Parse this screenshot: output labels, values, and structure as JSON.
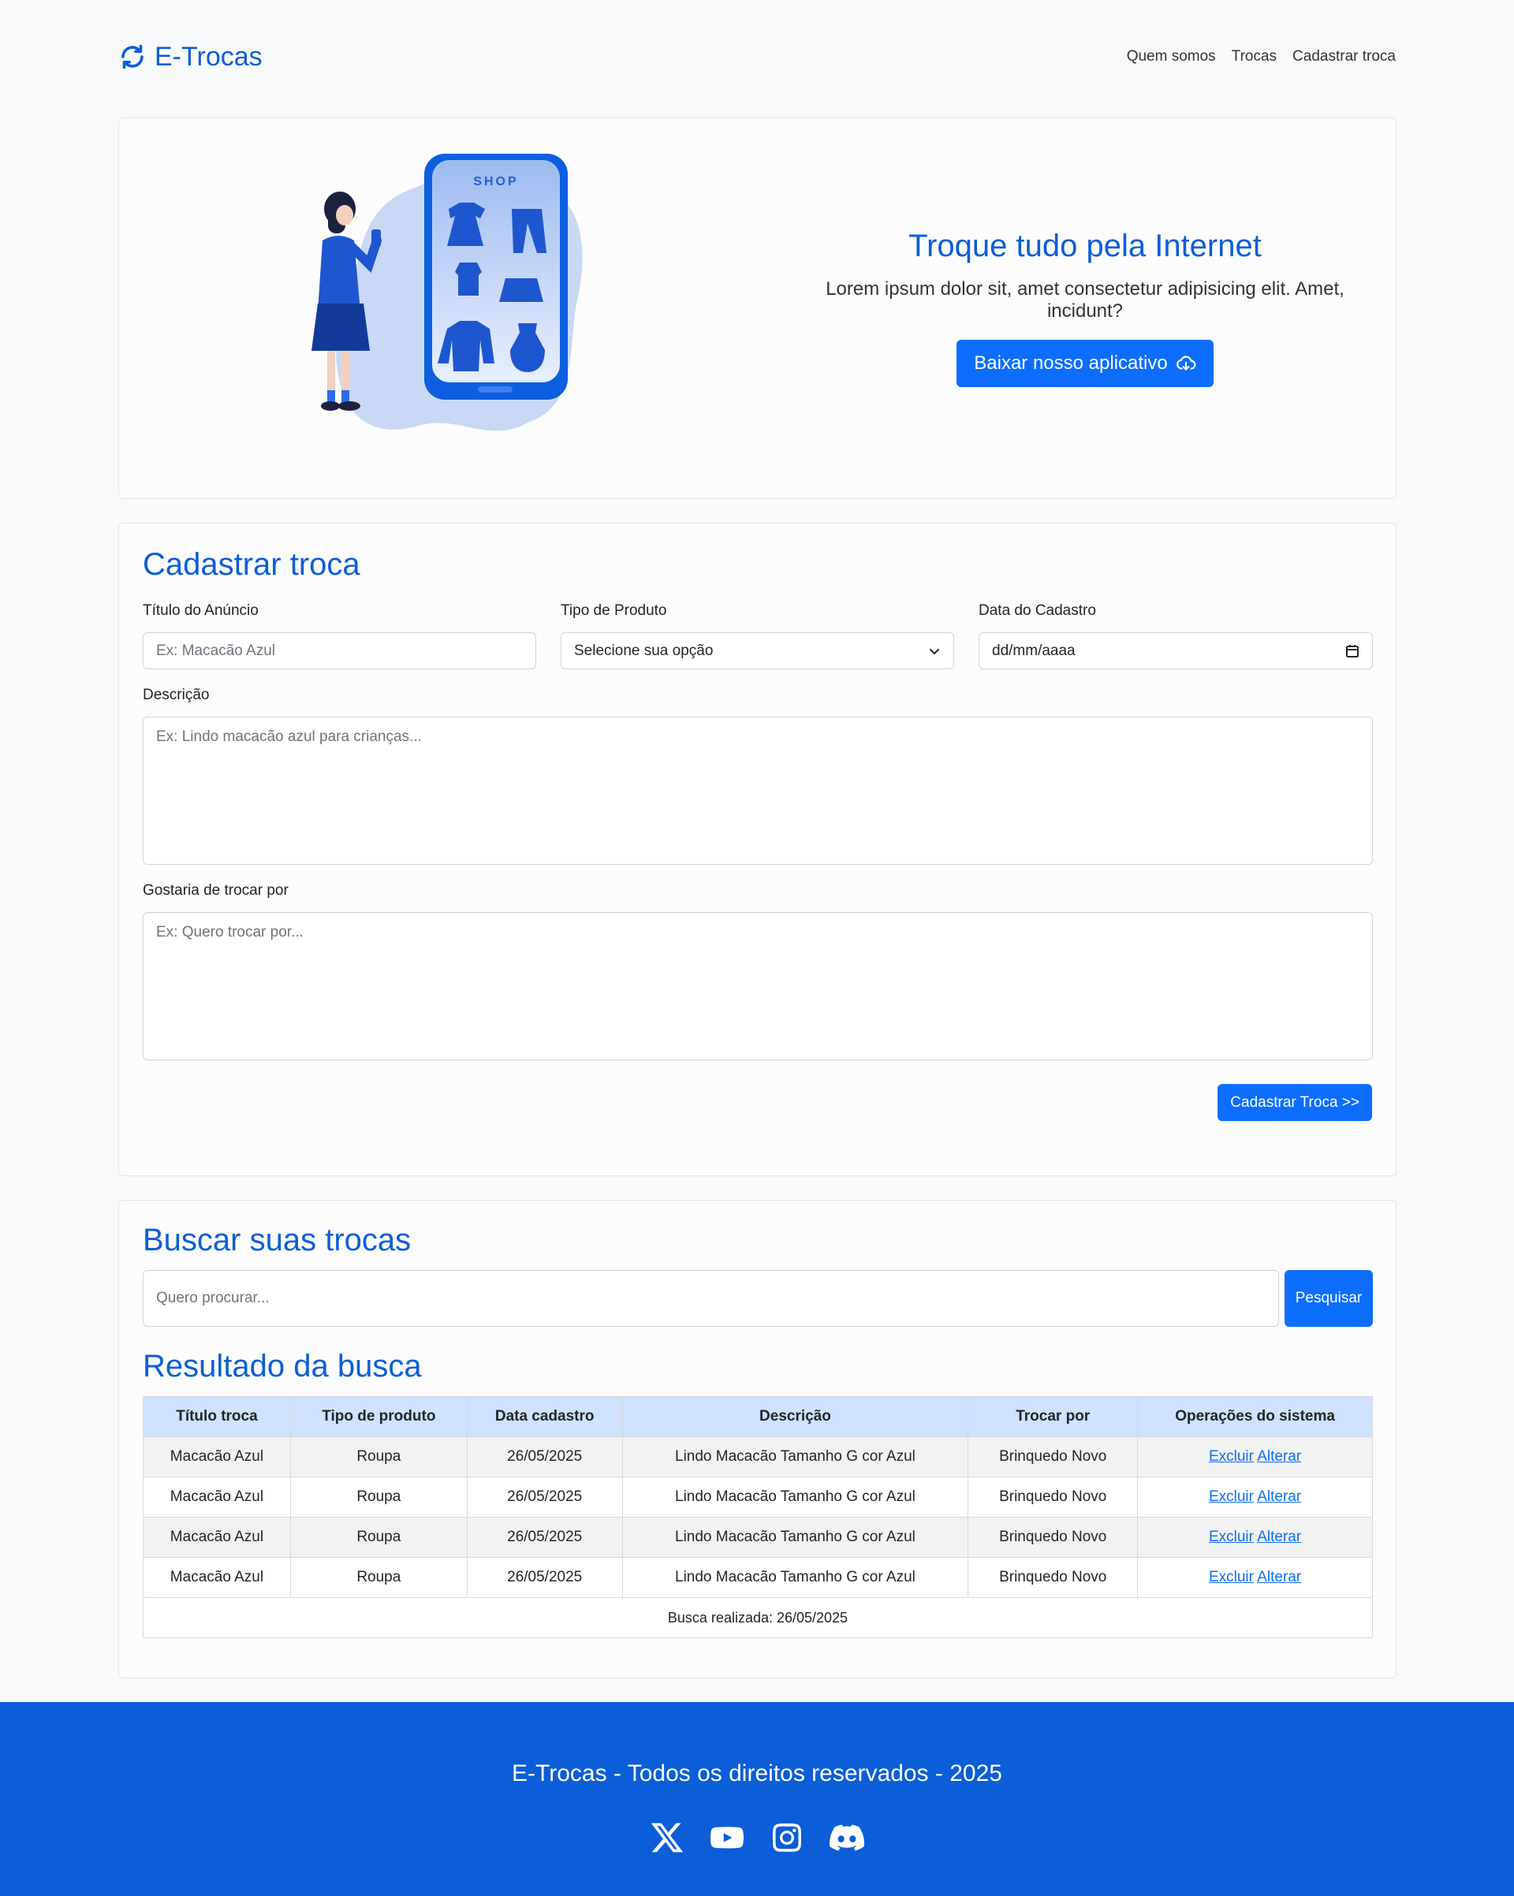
{
  "header": {
    "brand": "E-Trocas",
    "nav": [
      "Quem somos",
      "Trocas",
      "Cadastrar troca"
    ]
  },
  "hero": {
    "title": "Troque tudo pela Internet",
    "subtitle": "Lorem ipsum dolor sit, amet consectetur adipisicing elit. Amet, incidunt?",
    "button_label": "Baixar nosso aplicativo",
    "illustration_text": "SHOP"
  },
  "form": {
    "title": "Cadastrar troca",
    "titulo_label": "Título do Anúncio",
    "titulo_placeholder": "Ex: Macacão Azul",
    "tipo_label": "Tipo de Produto",
    "tipo_value": "Selecione sua opção",
    "data_label": "Data do Cadastro",
    "data_value": "dd/mm/aaaa",
    "descricao_label": "Descrição",
    "descricao_placeholder": "Ex: Lindo macacão azul para crianças...",
    "trocar_label": "Gostaria de trocar por",
    "trocar_placeholder": "Ex: Quero trocar por...",
    "submit_label": "Cadastrar Troca >>"
  },
  "search": {
    "title": "Buscar suas trocas",
    "placeholder": "Quero procurar...",
    "button_label": "Pesquisar",
    "results_title": "Resultado da busca",
    "columns": [
      "Título troca",
      "Tipo de produto",
      "Data cadastro",
      "Descrição",
      "Trocar por",
      "Operações do sistema"
    ],
    "rows": [
      {
        "titulo": "Macacão Azul",
        "tipo": "Roupa",
        "data": "26/05/2025",
        "descricao": "Lindo Macacão Tamanho G cor Azul",
        "trocar": "Brinquedo Novo",
        "excluir": "Excluir",
        "alterar": "Alterar"
      },
      {
        "titulo": "Macacão Azul",
        "tipo": "Roupa",
        "data": "26/05/2025",
        "descricao": "Lindo Macacão Tamanho G cor Azul",
        "trocar": "Brinquedo Novo",
        "excluir": "Excluir",
        "alterar": "Alterar"
      },
      {
        "titulo": "Macacão Azul",
        "tipo": "Roupa",
        "data": "26/05/2025",
        "descricao": "Lindo Macacão Tamanho G cor Azul",
        "trocar": "Brinquedo Novo",
        "excluir": "Excluir",
        "alterar": "Alterar"
      },
      {
        "titulo": "Macacão Azul",
        "tipo": "Roupa",
        "data": "26/05/2025",
        "descricao": "Lindo Macacão Tamanho G cor Azul",
        "trocar": "Brinquedo Novo",
        "excluir": "Excluir",
        "alterar": "Alterar"
      }
    ],
    "footer_note": "Busca realizada: 26/05/2025"
  },
  "footer": {
    "text": "E-Trocas - Todos os direitos reservados - 2025",
    "socials": [
      "x-icon",
      "youtube-icon",
      "instagram-icon",
      "discord-icon"
    ]
  },
  "colors": {
    "primary": "#0d6efd",
    "brand": "#0b5ed7",
    "table_header": "#cfe2ff"
  }
}
